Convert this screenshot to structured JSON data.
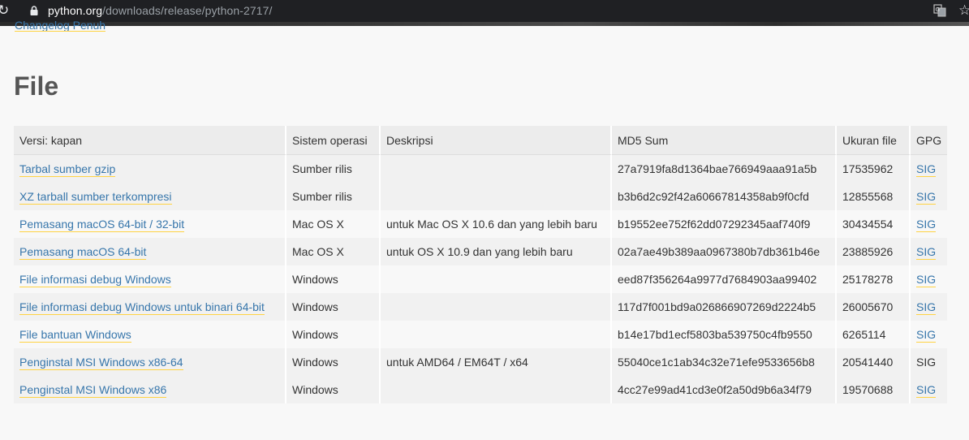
{
  "browser": {
    "url_host": "python.org",
    "url_path": "/downloads/release/python-2717/"
  },
  "page": {
    "cut_link": "Changelog Penuh",
    "heading": "File"
  },
  "table": {
    "headers": [
      "Versi: kapan",
      "Sistem operasi",
      "Deskripsi",
      "MD5 Sum",
      "Ukuran file",
      "GPG"
    ],
    "rows": [
      {
        "version": "Tarbal sumber gzip",
        "os": "Sumber rilis",
        "description": "",
        "md5": "27a7919fa8d1364bae766949aaa91a5b",
        "size": "17535962",
        "gpg": "SIG",
        "gpg_link": true
      },
      {
        "version": "XZ tarball sumber terkompresi",
        "os": "Sumber rilis",
        "description": "",
        "md5": "b3b6d2c92f42a60667814358ab9f0cfd",
        "size": "12855568",
        "gpg": "SIG",
        "gpg_link": true
      },
      {
        "version": "Pemasang macOS 64-bit / 32-bit",
        "os": "Mac OS X",
        "description": "untuk Mac OS X 10.6 dan yang lebih baru",
        "md5": "b19552ee752f62dd07292345aaf740f9",
        "size": "30434554",
        "gpg": "SIG",
        "gpg_link": true
      },
      {
        "version": "Pemasang macOS 64-bit",
        "os": "Mac OS X",
        "description": "untuk OS X 10.9 dan yang lebih baru",
        "md5": "02a7ae49b389aa0967380b7db361b46e",
        "size": "23885926",
        "gpg": "SIG",
        "gpg_link": true
      },
      {
        "version": "File informasi debug Windows",
        "os": "Windows",
        "description": "",
        "md5": "eed87f356264a9977d7684903aa99402",
        "size": "25178278",
        "gpg": "SIG",
        "gpg_link": true
      },
      {
        "version": "File informasi debug Windows untuk binari 64-bit",
        "os": "Windows",
        "description": "",
        "md5": "117d7f001bd9a026866907269d2224b5",
        "size": "26005670",
        "gpg": "SIG",
        "gpg_link": true
      },
      {
        "version": "File bantuan Windows",
        "os": "Windows",
        "description": "",
        "md5": "b14e17bd1ecf5803ba539750c4fb9550",
        "size": "6265114",
        "gpg": "SIG",
        "gpg_link": true
      },
      {
        "version": "Penginstal MSI Windows x86-64",
        "os": "Windows",
        "description": "untuk AMD64 / EM64T / x64",
        "md5": "55040ce1c1ab34c32e71efe9533656b8",
        "size": "20541440",
        "gpg": "SIG",
        "gpg_link": false
      },
      {
        "version": "Penginstal MSI Windows x86",
        "os": "Windows",
        "description": "",
        "md5": "4cc27e99ad41cd3e0f2a50d9b6a34f79",
        "size": "19570688",
        "gpg": "SIG",
        "gpg_link": true
      }
    ]
  },
  "icons": [
    "reload-icon",
    "lock-icon",
    "translate-icon",
    "bookmark-star-icon"
  ]
}
